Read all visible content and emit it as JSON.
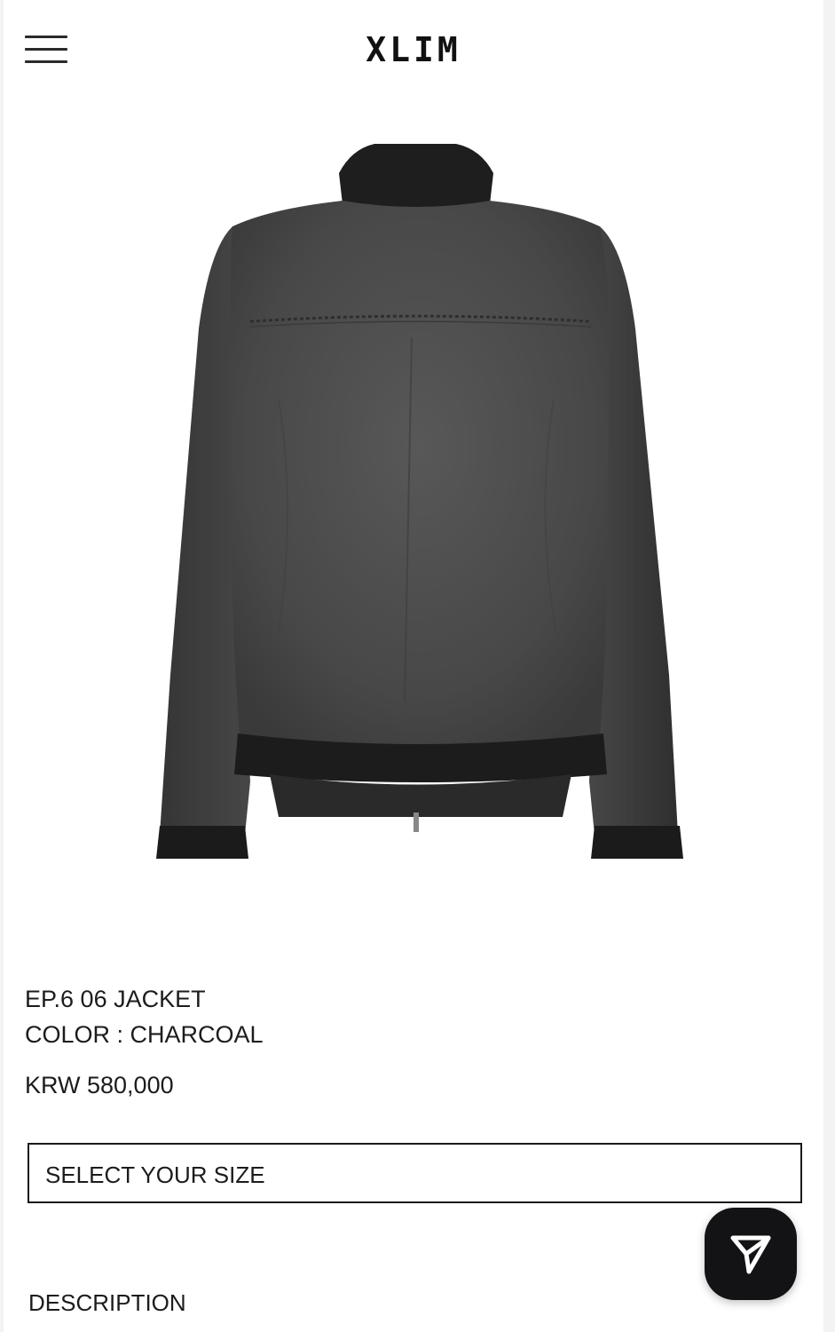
{
  "header": {
    "menu_icon": "hamburger-menu-icon",
    "logo": "XLIM"
  },
  "product": {
    "image_icon": "jacket-back-photo",
    "name": "EP.6 06 JACKET",
    "color": "COLOR : CHARCOAL",
    "price": "KRW 580,000"
  },
  "size_select": {
    "label": "SELECT YOUR SIZE"
  },
  "fab": {
    "icon": "send-paper-plane-icon",
    "background": "#131316"
  },
  "description": {
    "title": "DESCRIPTION"
  },
  "colors": {
    "jacket_body": "#4a4a4a",
    "jacket_ribbing": "#1e1e1e"
  }
}
